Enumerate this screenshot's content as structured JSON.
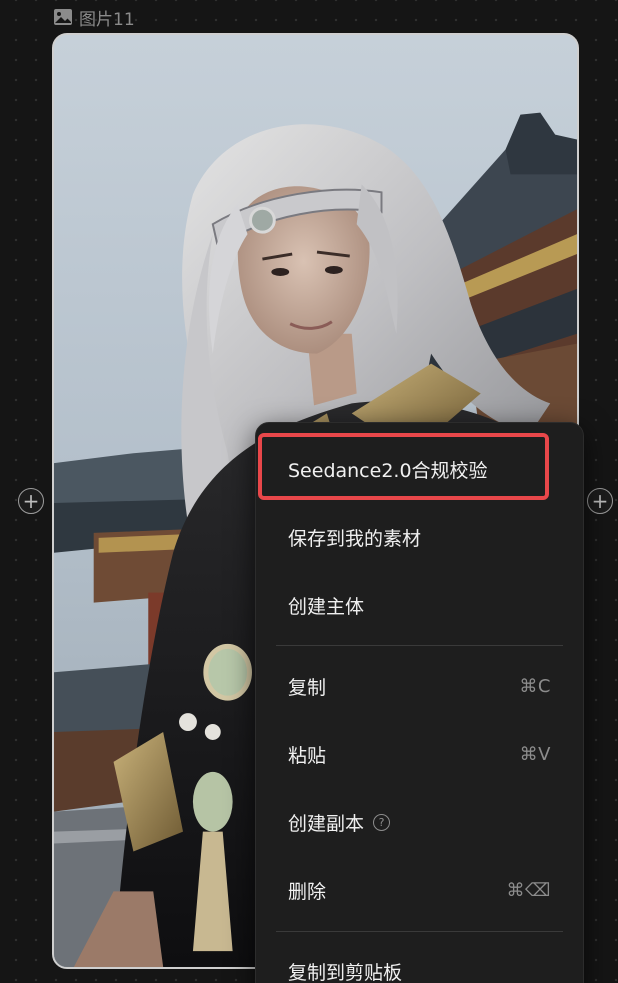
{
  "node": {
    "title": "图片11",
    "icon": "image-icon"
  },
  "connectors": {
    "left_symbol": "+",
    "right_symbol": "+"
  },
  "context_menu": {
    "highlight_color": "#e8474a",
    "items": [
      {
        "label": "Seedance2.0合规校验",
        "shortcut": ""
      },
      {
        "label": "保存到我的素材",
        "shortcut": ""
      },
      {
        "label": "创建主体",
        "shortcut": ""
      },
      {
        "label": "复制",
        "shortcut": "⌘C"
      },
      {
        "label": "粘贴",
        "shortcut": "⌘V"
      },
      {
        "label": "创建副本",
        "shortcut": "",
        "help": "?"
      },
      {
        "label": "删除",
        "shortcut": "⌘⌫"
      },
      {
        "label": "复制到剪贴板",
        "shortcut": ""
      }
    ]
  }
}
